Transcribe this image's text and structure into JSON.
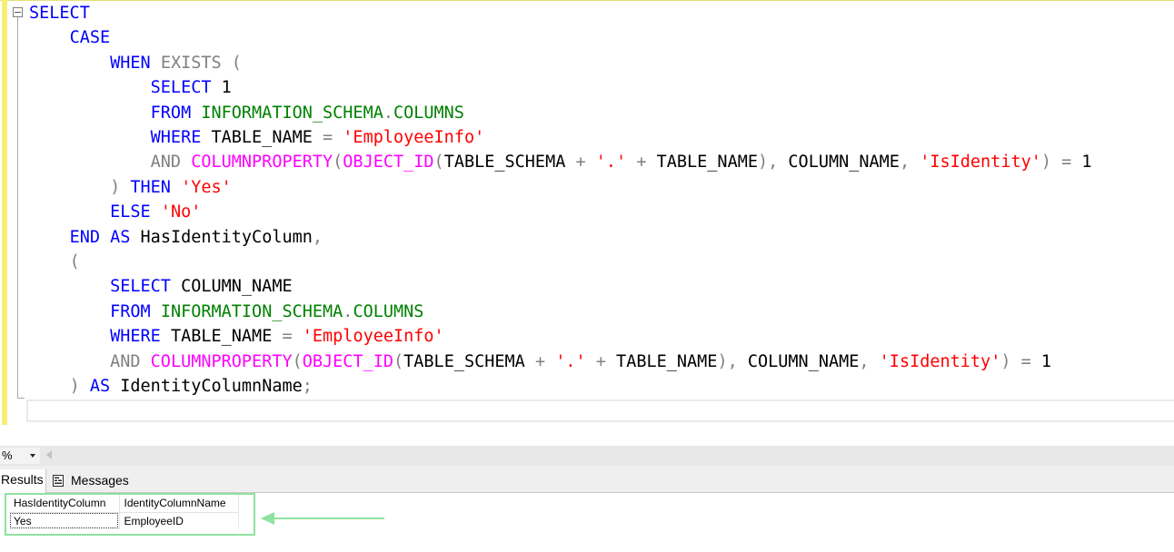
{
  "editor": {
    "code_lines": [
      [
        {
          "t": "SELECT",
          "c": "kw"
        }
      ],
      [
        {
          "t": "    "
        },
        {
          "t": "CASE",
          "c": "kw"
        }
      ],
      [
        {
          "t": "        "
        },
        {
          "t": "WHEN",
          "c": "kw"
        },
        {
          "t": " "
        },
        {
          "t": "EXISTS (",
          "c": "gr"
        }
      ],
      [
        {
          "t": "            "
        },
        {
          "t": "SELECT",
          "c": "kw"
        },
        {
          "t": " 1"
        }
      ],
      [
        {
          "t": "            "
        },
        {
          "t": "FROM",
          "c": "kw"
        },
        {
          "t": " "
        },
        {
          "t": "INFORMATION_SCHEMA",
          "c": "sy"
        },
        {
          "t": ".",
          "c": "gr"
        },
        {
          "t": "COLUMNS",
          "c": "sy"
        }
      ],
      [
        {
          "t": "            "
        },
        {
          "t": "WHERE",
          "c": "kw"
        },
        {
          "t": " TABLE_NAME "
        },
        {
          "t": "=",
          "c": "gr"
        },
        {
          "t": " "
        },
        {
          "t": "'EmployeeInfo'",
          "c": "st"
        }
      ],
      [
        {
          "t": "            "
        },
        {
          "t": "AND",
          "c": "gr"
        },
        {
          "t": " "
        },
        {
          "t": "COLUMNPROPERTY",
          "c": "fn"
        },
        {
          "t": "(",
          "c": "gr"
        },
        {
          "t": "OBJECT_ID",
          "c": "fn"
        },
        {
          "t": "(",
          "c": "gr"
        },
        {
          "t": "TABLE_SCHEMA "
        },
        {
          "t": "+",
          "c": "gr"
        },
        {
          "t": " "
        },
        {
          "t": "'.'",
          "c": "st"
        },
        {
          "t": " "
        },
        {
          "t": "+",
          "c": "gr"
        },
        {
          "t": " TABLE_NAME"
        },
        {
          "t": "),",
          "c": "gr"
        },
        {
          "t": " COLUMN_NAME"
        },
        {
          "t": ",",
          "c": "gr"
        },
        {
          "t": " "
        },
        {
          "t": "'IsIdentity'",
          "c": "st"
        },
        {
          "t": ")",
          "c": "gr"
        },
        {
          "t": " "
        },
        {
          "t": "=",
          "c": "gr"
        },
        {
          "t": " 1"
        }
      ],
      [
        {
          "t": "        "
        },
        {
          "t": ")",
          "c": "gr"
        },
        {
          "t": " "
        },
        {
          "t": "THEN",
          "c": "kw"
        },
        {
          "t": " "
        },
        {
          "t": "'Yes'",
          "c": "st"
        }
      ],
      [
        {
          "t": "        "
        },
        {
          "t": "ELSE",
          "c": "kw"
        },
        {
          "t": " "
        },
        {
          "t": "'No'",
          "c": "st"
        }
      ],
      [
        {
          "t": "    "
        },
        {
          "t": "END",
          "c": "kw"
        },
        {
          "t": " "
        },
        {
          "t": "AS",
          "c": "kw"
        },
        {
          "t": " HasIdentityColumn"
        },
        {
          "t": ",",
          "c": "gr"
        }
      ],
      [
        {
          "t": "    "
        },
        {
          "t": "(",
          "c": "gr"
        }
      ],
      [
        {
          "t": "        "
        },
        {
          "t": "SELECT",
          "c": "kw"
        },
        {
          "t": " COLUMN_NAME"
        }
      ],
      [
        {
          "t": "        "
        },
        {
          "t": "FROM",
          "c": "kw"
        },
        {
          "t": " "
        },
        {
          "t": "INFORMATION_SCHEMA",
          "c": "sy"
        },
        {
          "t": ".",
          "c": "gr"
        },
        {
          "t": "COLUMNS",
          "c": "sy"
        }
      ],
      [
        {
          "t": "        "
        },
        {
          "t": "WHERE",
          "c": "kw"
        },
        {
          "t": " TABLE_NAME "
        },
        {
          "t": "=",
          "c": "gr"
        },
        {
          "t": " "
        },
        {
          "t": "'EmployeeInfo'",
          "c": "st"
        }
      ],
      [
        {
          "t": "        "
        },
        {
          "t": "AND",
          "c": "gr"
        },
        {
          "t": " "
        },
        {
          "t": "COLUMNPROPERTY",
          "c": "fn"
        },
        {
          "t": "(",
          "c": "gr"
        },
        {
          "t": "OBJECT_ID",
          "c": "fn"
        },
        {
          "t": "(",
          "c": "gr"
        },
        {
          "t": "TABLE_SCHEMA "
        },
        {
          "t": "+",
          "c": "gr"
        },
        {
          "t": " "
        },
        {
          "t": "'.'",
          "c": "st"
        },
        {
          "t": " "
        },
        {
          "t": "+",
          "c": "gr"
        },
        {
          "t": " TABLE_NAME"
        },
        {
          "t": "),",
          "c": "gr"
        },
        {
          "t": " COLUMN_NAME"
        },
        {
          "t": ",",
          "c": "gr"
        },
        {
          "t": " "
        },
        {
          "t": "'IsIdentity'",
          "c": "st"
        },
        {
          "t": ")",
          "c": "gr"
        },
        {
          "t": " "
        },
        {
          "t": "=",
          "c": "gr"
        },
        {
          "t": " 1"
        }
      ],
      [
        {
          "t": "    "
        },
        {
          "t": ")",
          "c": "gr"
        },
        {
          "t": " "
        },
        {
          "t": "AS",
          "c": "kw"
        },
        {
          "t": " IdentityColumnName"
        },
        {
          "t": ";",
          "c": "gr"
        }
      ]
    ],
    "collapse_icon": "collapse-minus-icon"
  },
  "colors": {
    "keyword": "#0000ff",
    "operator": "#808080",
    "function": "#ff00ff",
    "string": "#ff0000",
    "system_object": "#008000",
    "change_bar": "#f5ef74",
    "highlight_box": "#8fe29f"
  },
  "zoom": {
    "value": "%",
    "dropdown_icon": "chevron-down-icon",
    "scroll_icon": "scroll-left-icon"
  },
  "results_tabs": {
    "results_label": "Results",
    "messages_label": "Messages",
    "messages_icon": "messages-icon"
  },
  "result_grid": {
    "columns": [
      "HasIdentityColumn",
      "IdentityColumnName"
    ],
    "rows": [
      [
        "Yes",
        "EmployeeID"
      ]
    ]
  },
  "annotation": {
    "arrow_icon": "arrow-left-icon"
  }
}
